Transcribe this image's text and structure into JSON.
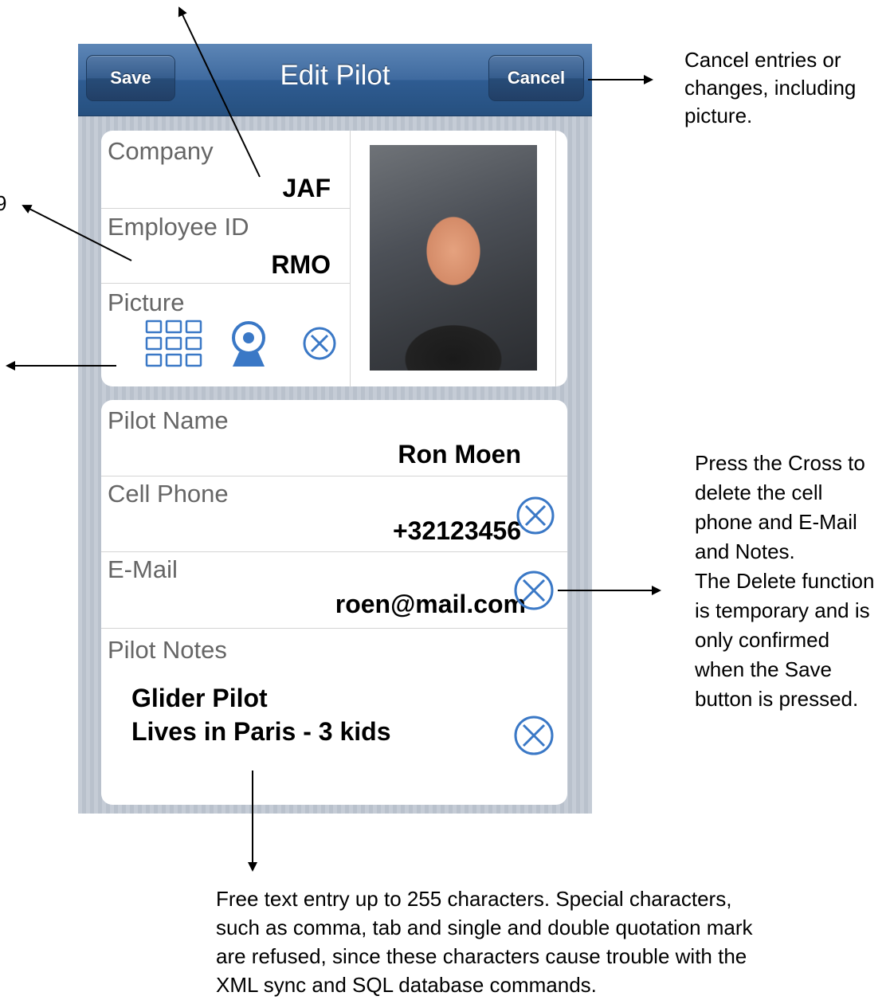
{
  "navbar": {
    "title": "Edit Pilot",
    "save_label": "Save",
    "cancel_label": "Cancel",
    "bar_color": "#2f5c92"
  },
  "card1": {
    "company_label": "Company",
    "company_value": "JAF",
    "employee_label": "Employee ID",
    "employee_value": "RMO",
    "picture_label": "Picture"
  },
  "card2": {
    "name_label": "Pilot Name",
    "name_value": "Ron Moen",
    "phone_label": "Cell Phone",
    "phone_value": "+32123456",
    "email_label": "E-Mail",
    "email_value": "roen@mail.com",
    "notes_label": "Pilot Notes",
    "notes_line1": "Glider Pilot",
    "notes_line2": "Lives in Paris - 3 kids"
  },
  "icons": {
    "photo_library": "grid-icon",
    "camera": "camera-icon",
    "delete": "clear-circle-icon",
    "icon_color": "#3a78c6"
  },
  "annotations": {
    "left_partial": "9",
    "cancel_note": [
      "Cancel entries or",
      "changes, including",
      "picture."
    ],
    "delete_note": [
      "Press the Cross to",
      "delete the cell",
      "phone and E-Mail",
      "and Notes.",
      "The Delete function",
      "is temporary and is",
      "only confirmed",
      "when the Save",
      "button is pressed."
    ],
    "notes_note": [
      "Free text entry up to 255 characters.  Special characters,",
      "such as comma, tab and single and double quotation mark",
      "are refused, since these characters cause trouble with the",
      "XML sync and SQL database commands."
    ]
  }
}
